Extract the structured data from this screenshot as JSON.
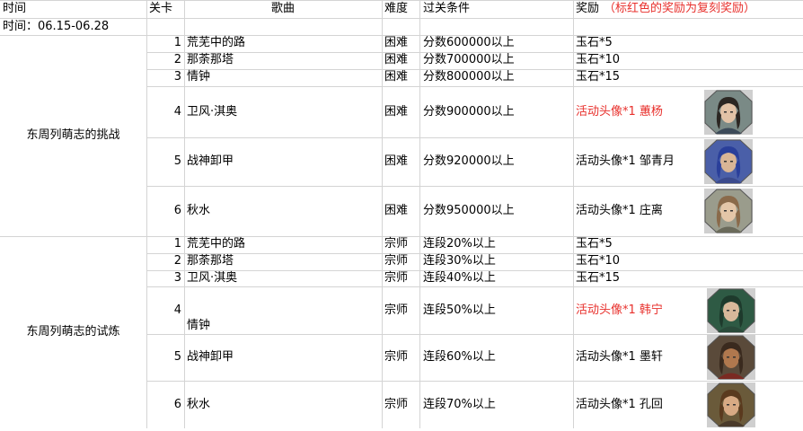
{
  "header": {
    "time": "时间",
    "stage": "关卡",
    "song": "歌曲",
    "difficulty": "难度",
    "condition": "过关条件",
    "reward": "奖励",
    "reward_note": "（标红色的奖励为复刻奖励）"
  },
  "time_row": "时间：06.15-06.28",
  "groups": [
    {
      "name": "东周列萌志的挑战",
      "rows": [
        {
          "stage": "1",
          "song": "荒芜中的路",
          "difficulty": "困难",
          "condition": "分数600000以上",
          "reward": "玉石*5",
          "highlight": false
        },
        {
          "stage": "2",
          "song": "那荼那塔",
          "difficulty": "困难",
          "condition": "分数700000以上",
          "reward": "玉石*10",
          "highlight": false
        },
        {
          "stage": "3",
          "song": "情钟",
          "difficulty": "困难",
          "condition": "分数800000以上",
          "reward": "玉石*15",
          "highlight": false
        },
        {
          "stage": "4",
          "song": "卫风·淇奥",
          "difficulty": "困难",
          "condition": "分数900000以上",
          "reward": "活动头像*1 蕙杨",
          "highlight": true,
          "avatar": {
            "hair": "#2b2622",
            "skin": "#e2c2a6",
            "bg": "#7a8a86",
            "cloth": "#3c4a58"
          }
        },
        {
          "stage": "5",
          "song": "战神卸甲",
          "difficulty": "困难",
          "condition": "分数920000以上",
          "reward": "活动头像*1 邹青月",
          "highlight": false,
          "avatar": {
            "hair": "#2a3f9a",
            "skin": "#d9b596",
            "bg": "#4a5fa8",
            "cloth": "#3b4a8c"
          }
        },
        {
          "stage": "6",
          "song": "秋水",
          "difficulty": "困难",
          "condition": "分数950000以上",
          "reward": "活动头像*1 庄离",
          "highlight": false,
          "avatar": {
            "hair": "#8a6a4a",
            "skin": "#e4c6a8",
            "bg": "#9a9c8c",
            "cloth": "#6a6a5a"
          }
        }
      ]
    },
    {
      "name": "东周列萌志的试炼",
      "rows": [
        {
          "stage": "1",
          "song": "荒芜中的路",
          "difficulty": "宗师",
          "condition": "连段20%以上",
          "reward": "玉石*5",
          "highlight": false
        },
        {
          "stage": "2",
          "song": "那荼那塔",
          "difficulty": "宗师",
          "condition": "连段30%以上",
          "reward": "玉石*10",
          "highlight": false
        },
        {
          "stage": "3",
          "song": "卫风·淇奥",
          "difficulty": "宗师",
          "condition": "连段40%以上",
          "reward": "玉石*15",
          "highlight": false
        },
        {
          "stage": "4",
          "song": "情钟",
          "difficulty": "宗师",
          "condition": "连段50%以上",
          "reward": "活动头像*1 韩宁",
          "highlight": true,
          "avatar": {
            "hair": "#1e3a2c",
            "skin": "#d8b89a",
            "bg": "#2e5a44",
            "cloth": "#2a4a3a"
          }
        },
        {
          "stage": "5",
          "song": "战神卸甲",
          "difficulty": "宗师",
          "condition": "连段60%以上",
          "reward": "活动头像*1 墨轩",
          "highlight": false,
          "avatar": {
            "hair": "#3a2a1e",
            "skin": "#b0784e",
            "bg": "#5a4a3a",
            "cloth": "#7a2a22"
          }
        },
        {
          "stage": "6",
          "song": "秋水",
          "difficulty": "宗师",
          "condition": "连段70%以上",
          "reward": "活动头像*1 孔回",
          "highlight": false,
          "avatar": {
            "hair": "#5a3a1e",
            "skin": "#d8aa84",
            "bg": "#6a5a3a",
            "cloth": "#4a3a2a"
          }
        }
      ]
    }
  ],
  "colors": {
    "highlight": "#e8302c",
    "grid": "#d4d4d4"
  }
}
